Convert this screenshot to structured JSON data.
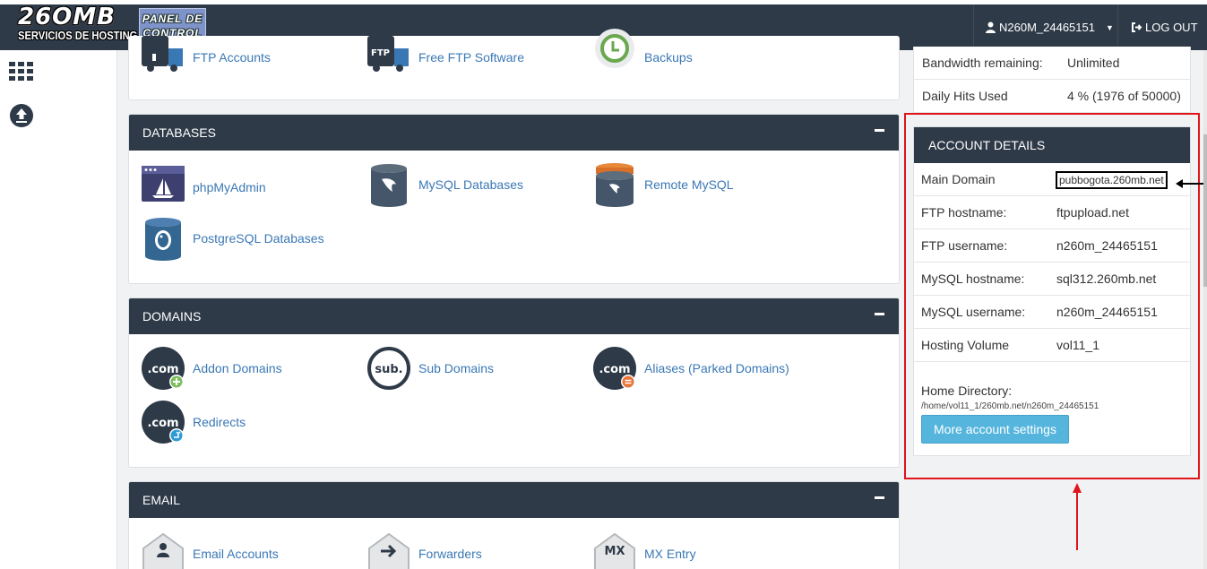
{
  "header": {
    "logo_main": "26OMB",
    "logo_sub": "SERVICIOS DE HOSTING",
    "panel_line1": "PANEL DE",
    "panel_line2": "CONTROL",
    "username": "N260M_24465151",
    "logout": "LOG OUT"
  },
  "files_row": {
    "items": [
      {
        "label": "FTP Accounts",
        "icon": "ftp-truck-icon"
      },
      {
        "label": "Free FTP Software",
        "icon": "ftp-truck-icon"
      },
      {
        "label": "Backups",
        "icon": "backup-clock-icon"
      }
    ]
  },
  "databases": {
    "title": "DATABASES",
    "items": [
      {
        "label": "phpMyAdmin",
        "icon": "phpmyadmin-icon"
      },
      {
        "label": "MySQL Databases",
        "icon": "mysql-icon"
      },
      {
        "label": "Remote MySQL",
        "icon": "remote-mysql-icon"
      },
      {
        "label": "PostgreSQL Databases",
        "icon": "postgresql-icon"
      }
    ]
  },
  "domains": {
    "title": "DOMAINS",
    "items": [
      {
        "label": "Addon Domains",
        "icon_text": ".com"
      },
      {
        "label": "Sub Domains",
        "icon_text": "sub."
      },
      {
        "label": "Aliases (Parked Domains)",
        "icon_text": ".com"
      },
      {
        "label": "Redirects",
        "icon_text": ".com"
      }
    ]
  },
  "email": {
    "title": "EMAIL",
    "items": [
      {
        "label": "Email Accounts",
        "icon": "email-account-icon"
      },
      {
        "label": "Forwarders",
        "icon": "forwarder-icon"
      },
      {
        "label": "MX Entry",
        "icon_text": "MX"
      }
    ]
  },
  "stats": [
    {
      "key": "Bandwidth remaining:",
      "value": "Unlimited"
    },
    {
      "key": "Daily Hits Used",
      "value": "4 % (1976 of 50000)"
    }
  ],
  "account": {
    "title": "ACCOUNT DETAILS",
    "rows": [
      {
        "key": "Main Domain",
        "value": "pubbogota.260mb.net"
      },
      {
        "key": "FTP hostname:",
        "value": "ftpupload.net"
      },
      {
        "key": "FTP username:",
        "value": "n260m_24465151"
      },
      {
        "key": "MySQL hostname:",
        "value": "sql312.260mb.net"
      },
      {
        "key": "MySQL username:",
        "value": "n260m_24465151"
      },
      {
        "key": "Hosting Volume",
        "value": "vol11_1"
      }
    ],
    "home_label": "Home Directory:",
    "home_path": "/home/vol11_1/260mb.net/n260m_24465151",
    "more_button": "More account settings"
  },
  "colors": {
    "header_bg": "#2e3a48",
    "link": "#3a78b5",
    "highlight_red": "#e0141b",
    "button": "#55b5dd"
  }
}
